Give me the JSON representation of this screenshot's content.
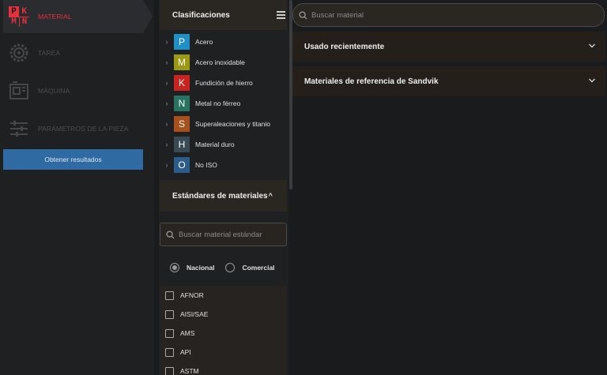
{
  "nav": {
    "items": [
      {
        "label": "MATERIAL",
        "icon": "pkmn-logo",
        "active": true
      },
      {
        "label": "TAREA",
        "icon": "task-gear-icon",
        "active": false
      },
      {
        "label": "MÁQUINA",
        "icon": "machine-icon",
        "active": false
      },
      {
        "label": "PARÁMETROS DE LA PIEZA",
        "icon": "sliders-icon",
        "active": false
      }
    ],
    "logo_letters": [
      "P",
      "K",
      "M",
      "N"
    ],
    "results_button": "Obtener resultados"
  },
  "classifications": {
    "title": "Clasificaciones",
    "items": [
      {
        "code": "P",
        "label": "Acero",
        "color": "#1f8fc8"
      },
      {
        "code": "M",
        "label": "Acero inoxidable",
        "color": "#9c9a12"
      },
      {
        "code": "K",
        "label": "Fundición de hierro",
        "color": "#c8231f"
      },
      {
        "code": "N",
        "label": "Metal no férreo",
        "color": "#27735f"
      },
      {
        "code": "S",
        "label": "Superaleaciones y titanio",
        "color": "#a8501b"
      },
      {
        "code": "H",
        "label": "Material duro",
        "color": "#3a4a55"
      },
      {
        "code": "O",
        "label": "No ISO",
        "color": "#2c5c8a"
      }
    ]
  },
  "standards": {
    "title": "Estándares de materiales",
    "caret": "^",
    "search_placeholder": "Buscar material estándar",
    "radio_national": "Nacional",
    "radio_commercial": "Comercial",
    "selected": "Nacional",
    "list": [
      "AFNOR",
      "AISI/SAE",
      "AMS",
      "API",
      "ASTM"
    ]
  },
  "main": {
    "search_placeholder": "Buscar material",
    "sections": [
      "Usado recientemente",
      "Materiales de referencia de Sandvik"
    ]
  },
  "colors": {
    "accent_red": "#e3323c",
    "button_blue": "#2f6aa3"
  }
}
